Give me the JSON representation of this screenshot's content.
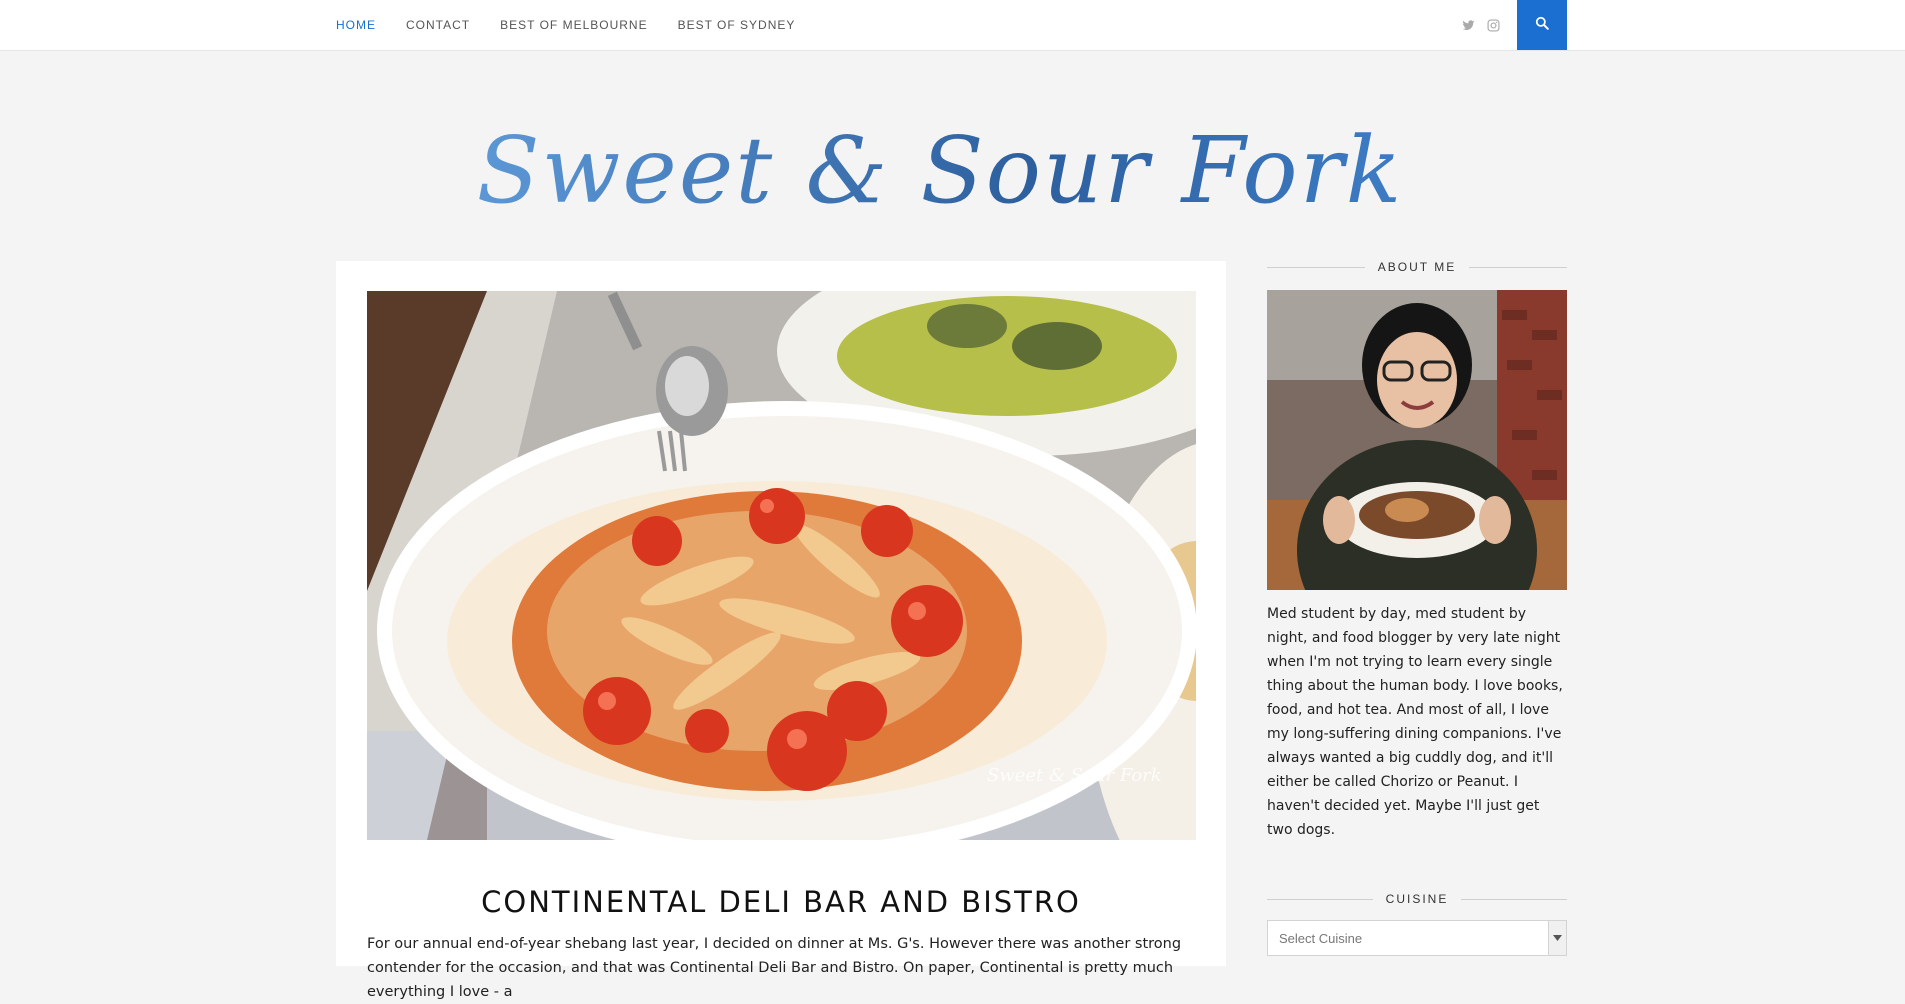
{
  "nav": {
    "items": [
      {
        "label": "HOME",
        "active": true
      },
      {
        "label": "CONTACT",
        "active": false
      },
      {
        "label": "BEST OF MELBOURNE",
        "active": false
      },
      {
        "label": "BEST OF SYDNEY",
        "active": false
      }
    ],
    "social_icons": [
      "twitter-icon",
      "instagram-icon"
    ],
    "search_icon": "search-icon"
  },
  "brand": {
    "logo_text": "Sweet & Sour Fork",
    "accent_color": "#1a6fd1"
  },
  "post": {
    "image_watermark": "Sweet & Sour Fork",
    "title": "CONTINENTAL DELI BAR AND BISTRO",
    "excerpt": "For our annual end-of-year shebang last year, I decided on dinner at Ms. G's. However there was another strong contender for the occasion, and that was Continental Deli Bar and Bistro. On paper, Continental is pretty much everything I love - a"
  },
  "sidebar": {
    "about_title": "ABOUT ME",
    "about_text": "Med student by day, med student by night, and food blogger by very late night when I'm not trying to learn every single thing about the human body. I love books, food, and hot tea. And most of all, I love my long-suffering dining companions. I've always wanted a big cuddly dog, and it'll either be called Chorizo or Peanut. I haven't decided yet. Maybe I'll just get two dogs.",
    "cuisine_title": "CUISINE",
    "cuisine_select": "Select Cuisine"
  }
}
